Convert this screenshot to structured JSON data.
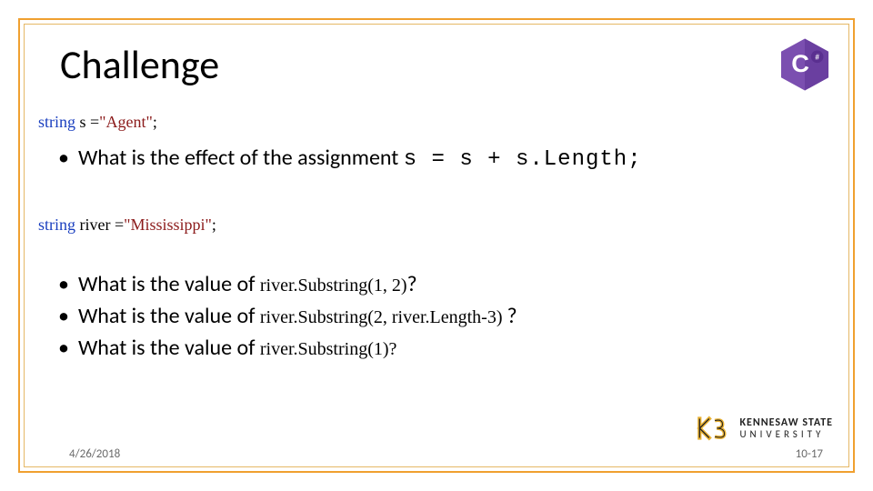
{
  "title": "Challenge",
  "line1": {
    "kw": "string",
    "var": " s =",
    "lit": "\"Agent\"",
    "tail": ";"
  },
  "bullet1_a": "What is the effect of the assignment ",
  "bullet1_code": "s = s + s.Length;",
  "line2": {
    "kw": "string",
    "var": " river =",
    "lit": "\"Mississippi\"",
    "tail": ";"
  },
  "b2_prefix": "What is the value of ",
  "b2_code": "river.Substring(1, 2)",
  "b2_suffix": "?",
  "b3_prefix": "What is the value of ",
  "b3_code": "river.Substring(2, river.Length-3) ",
  "b3_suffix": "?",
  "b4_prefix": "What is the value of ",
  "b4_code": "river.Substring(1)?",
  "ksu": {
    "line1": "KENNESAW STATE",
    "line2": "UNIVERSITY"
  },
  "footer": {
    "date": "4/26/2018",
    "page": "10-17"
  }
}
